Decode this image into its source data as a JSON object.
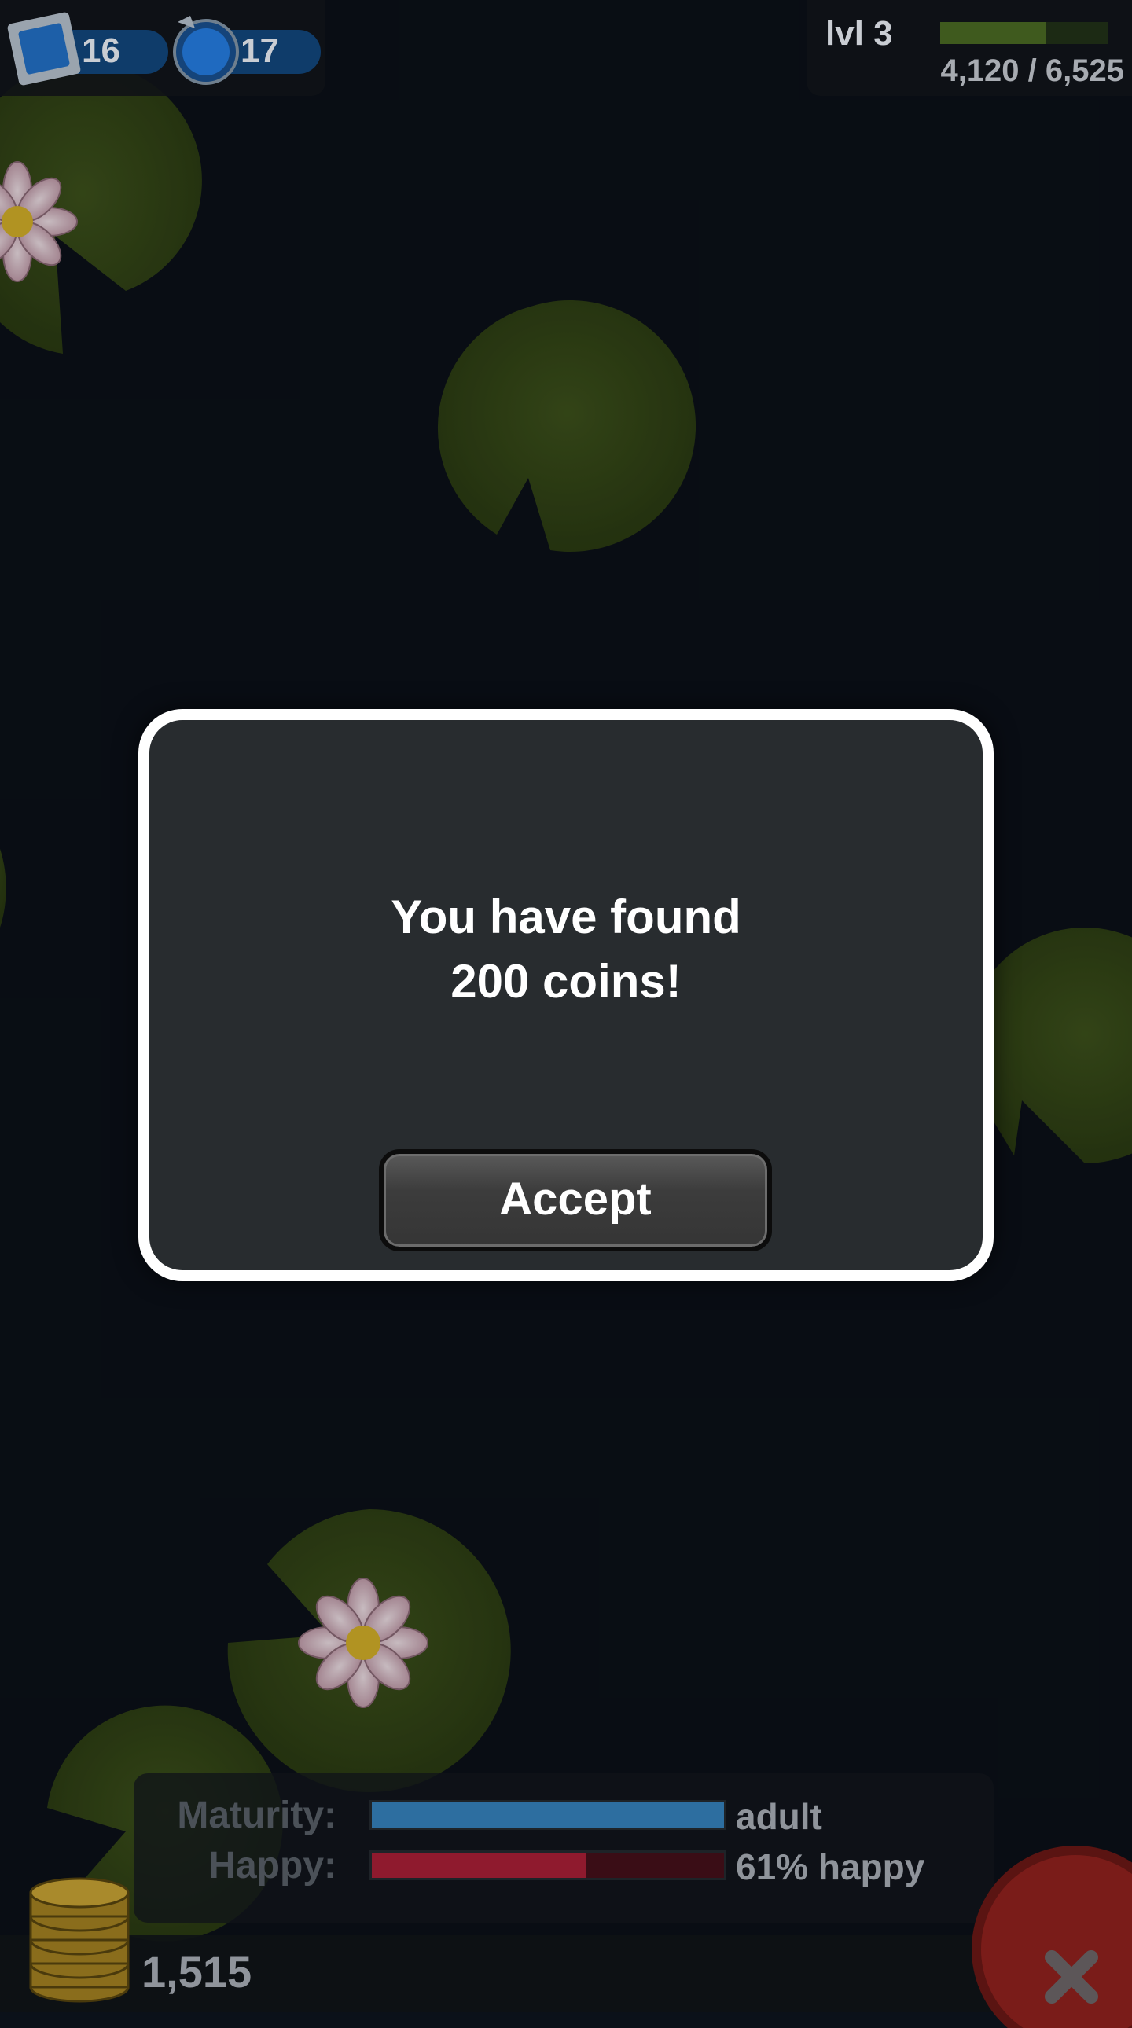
{
  "resources": {
    "stamps": {
      "icon": "stamp-icon",
      "count": "16"
    },
    "gems": {
      "icon": "blue-gem-icon",
      "count": "17"
    }
  },
  "level": {
    "label": "lvl 3",
    "xp_text": "4,120 / 6,525",
    "progress": 0.63
  },
  "dialog": {
    "message_line1": "You have found",
    "message_line2": "200 coins!",
    "accept_label": "Accept"
  },
  "status": {
    "maturity_label": "Maturity:",
    "maturity_value": "adult",
    "maturity_progress": 1.0,
    "happy_label": "Happy:",
    "happy_value": "61% happy",
    "happy_progress": 0.61
  },
  "coins": {
    "icon": "coin-stack-icon",
    "amount": "1,515"
  },
  "close": {
    "icon": "close-x-icon"
  },
  "colors": {
    "background": "#0b1119",
    "lily_pad": "#3a4d1a",
    "modal_bg": "#282c2f",
    "modal_border": "#ffffff",
    "maturity_bar": "#2d6ea0",
    "happy_bar": "#8f1a2e",
    "close_button": "#b3231f"
  }
}
